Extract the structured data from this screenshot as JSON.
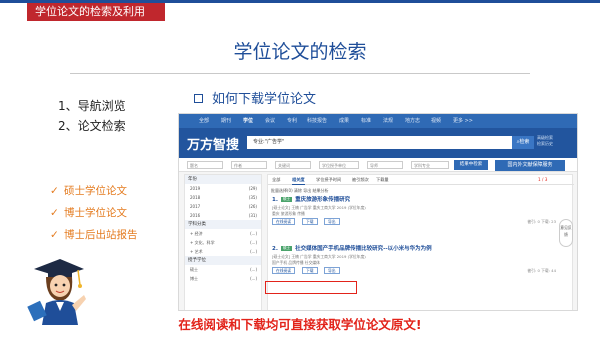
{
  "slide": {
    "topbar_label": "学位论文的检索及利用",
    "title": "学位论文的检索",
    "nav": [
      "1、导航浏览",
      "2、论文检索"
    ],
    "section_header": "如何下载学位论文",
    "check_items": [
      "硕士学位论文",
      "博士学位论文",
      "博士后出站报告"
    ],
    "footer_note": "在线阅读和下载均可直接获取学位论文原文!",
    "colors": {
      "primary": "#1f4e99",
      "accent": "#c0272d",
      "check": "#e47b1f",
      "note": "#e2231a"
    }
  },
  "screenshot": {
    "top_nav": [
      "全部",
      "期刊",
      "学位",
      "会议",
      "专利",
      "科技报告",
      "成果",
      "标准",
      "法规",
      "地方志",
      "视频",
      "更多 >>"
    ],
    "logo": "万方智搜",
    "search_value": "专业:\"广告学\"",
    "search_button": "检索",
    "search_links": [
      "高级检索",
      "检索历史"
    ],
    "filter_placeholders": [
      "题名",
      "作者",
      "关键词",
      "学位授予单位",
      "导师",
      "学科专业"
    ],
    "filter_button": "结果中检索",
    "side_button": "国内外文献保障服务",
    "sidebar": {
      "year_header": "年份",
      "years": [
        {
          "label": "2019",
          "count": "(29)"
        },
        {
          "label": "2018",
          "count": "(35)"
        },
        {
          "label": "2017",
          "count": "(26)"
        },
        {
          "label": "2016",
          "count": "(31)"
        }
      ],
      "subject_header": "学科分类",
      "subjects": [
        {
          "label": "+ 经济",
          "count": "(...)"
        },
        {
          "label": "+ 文化、科学",
          "count": "(...)"
        },
        {
          "label": "+ 艺术",
          "count": "(...)"
        }
      ],
      "degree_header": "授予学位",
      "degrees": [
        {
          "label": "硕士",
          "count": "(...)"
        },
        {
          "label": "博士",
          "count": "(...)"
        }
      ]
    },
    "tabs": [
      "全部",
      "相关度",
      "学位授予时间",
      "被引频次",
      "下载量"
    ],
    "tools": "批量选择(0)  清除  导出  结果分析",
    "results": [
      {
        "index": "1.",
        "tag": "硕士",
        "title": "重庆旅游形象传播研究",
        "meta": "[硕士论文] 王楠 广告学 重庆工商大学 2019 (学位年度)",
        "keywords": "重庆  旅游形象  传播",
        "actions": [
          "在线阅读",
          "下载",
          "导出"
        ],
        "stats": "被引: 0  下载: 23"
      },
      {
        "index": "2.",
        "tag": "硕士",
        "title": "社交媒体国产手机品牌传播比较研究--以小米与华为为例",
        "meta": "[硕士论文] 王楠 广告学 重庆工商大学 2019 (学位年度)",
        "keywords": "国产手机  品牌传播  社交媒体",
        "actions": [
          "在线阅读",
          "下载",
          "导出"
        ],
        "stats": "被引: 0  下载: 44"
      }
    ],
    "page_indicator": "1 / 3",
    "float_text": "意见反馈"
  }
}
